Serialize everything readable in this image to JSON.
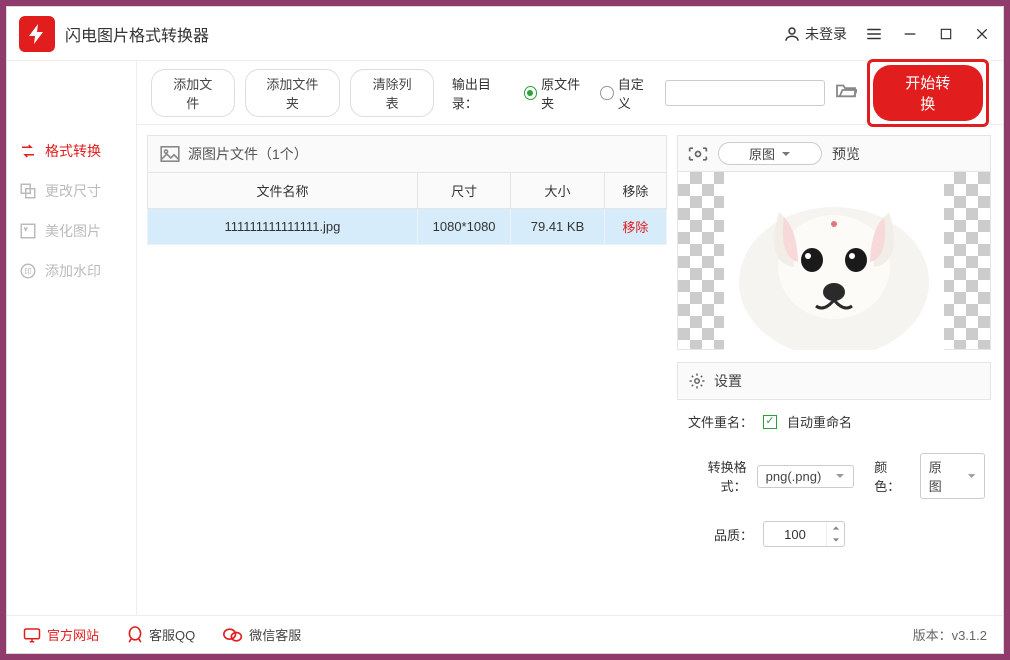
{
  "app": {
    "title": "闪电图片格式转换器"
  },
  "titlebar": {
    "login": "未登录"
  },
  "sidebar": {
    "items": [
      {
        "label": "格式转换",
        "icon": "convert-icon",
        "active": true
      },
      {
        "label": "更改尺寸",
        "icon": "resize-icon",
        "active": false
      },
      {
        "label": "美化图片",
        "icon": "beautify-icon",
        "active": false
      },
      {
        "label": "添加水印",
        "icon": "watermark-icon",
        "active": false
      }
    ]
  },
  "toolbar": {
    "add_file": "添加文件",
    "add_folder": "添加文件夹",
    "clear_list": "清除列表",
    "output_label": "输出目录：",
    "radio_src": "原文件夹",
    "radio_custom": "自定义",
    "convert": "开始转换"
  },
  "source": {
    "header": "源图片文件（1个）",
    "columns": {
      "name": "文件名称",
      "size": "尺寸",
      "filesize": "大小",
      "remove": "移除"
    },
    "rows": [
      {
        "name": "111111111111111.jpg",
        "size": "1080*1080",
        "filesize": "79.41 KB",
        "remove": "移除"
      }
    ]
  },
  "preview": {
    "pill": "原图",
    "label": "预览"
  },
  "settings": {
    "title": "设置",
    "rename_label": "文件重名：",
    "rename_auto": "自动重命名",
    "format_label": "转换格式：",
    "format_value": "png(.png)",
    "color_label": "颜色：",
    "color_value": "原图",
    "quality_label": "品质：",
    "quality_value": "100"
  },
  "status": {
    "website": "官方网站",
    "qq": "客服QQ",
    "wechat": "微信客服",
    "version": "版本：v3.1.2"
  }
}
